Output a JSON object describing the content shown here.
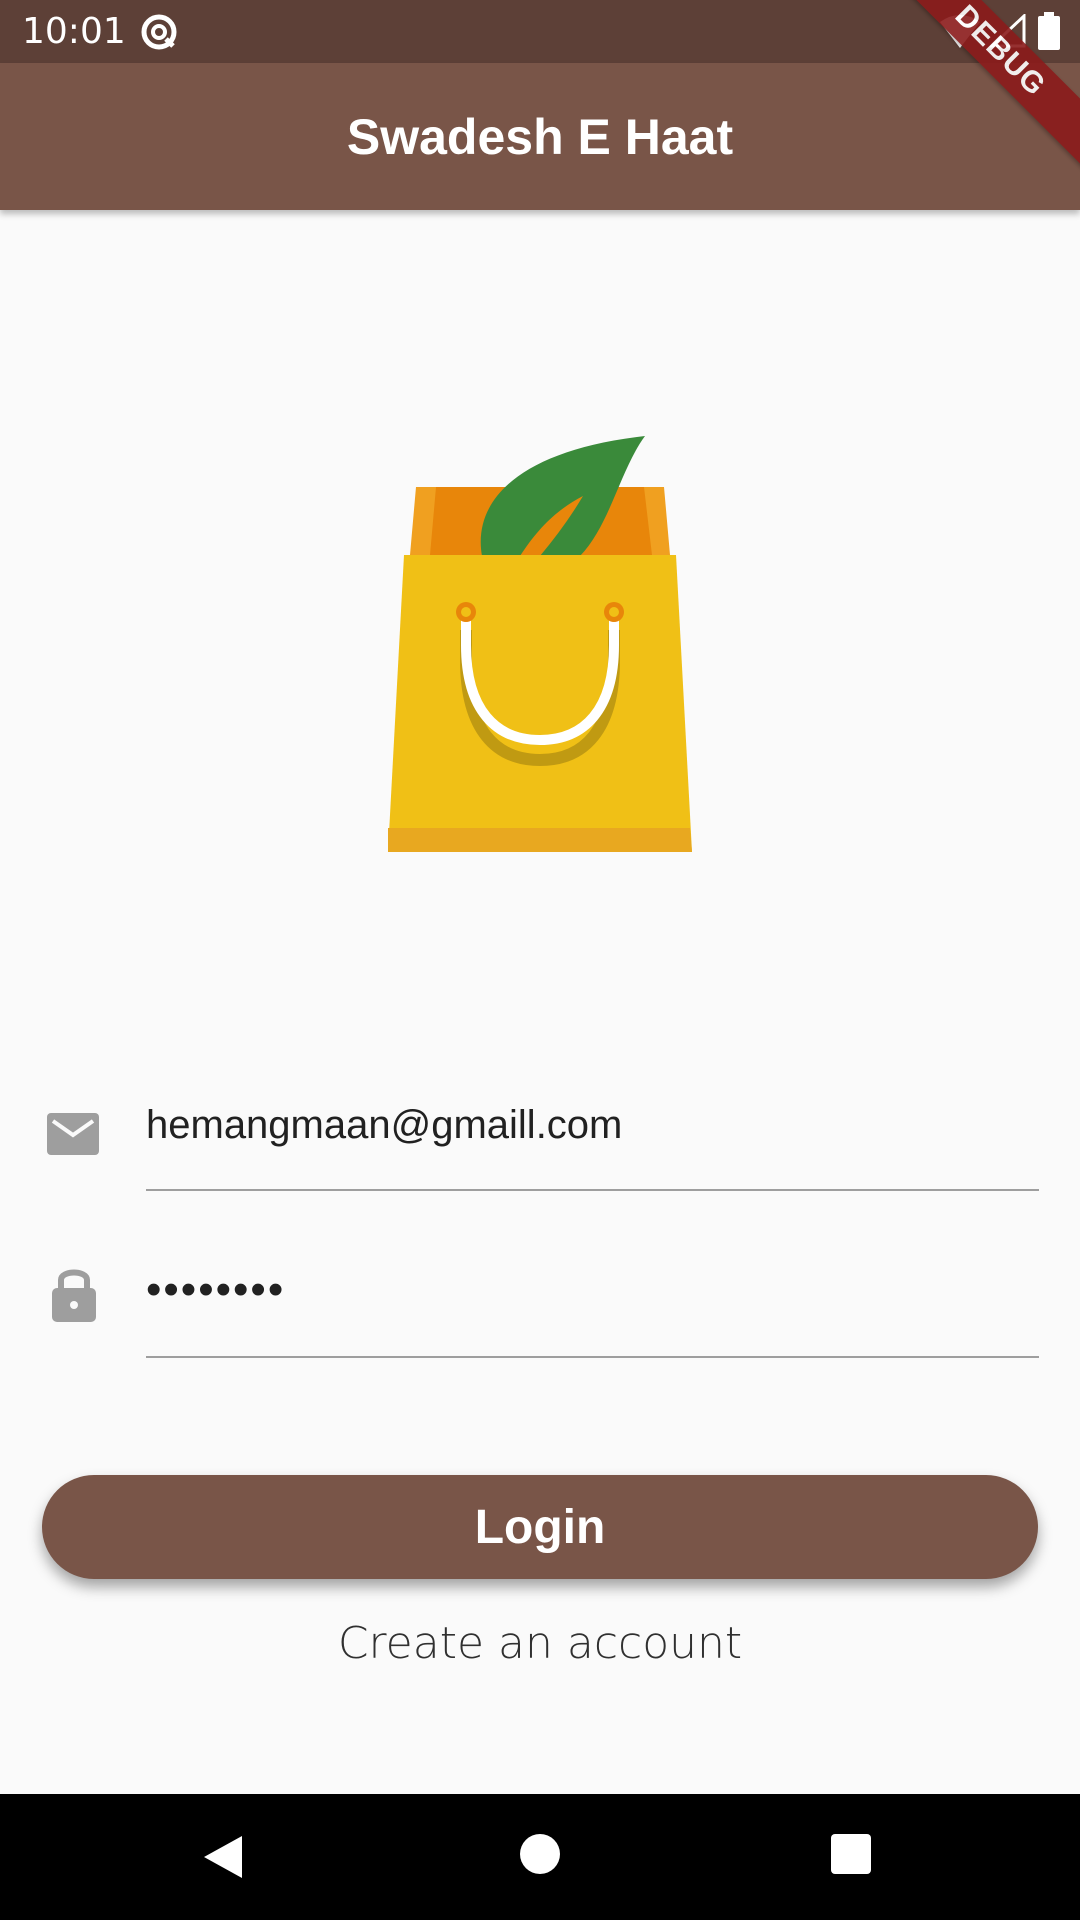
{
  "status_bar": {
    "time": "10:01",
    "app_icon": "at-sign-circle-icon",
    "icons": [
      "wifi-icon",
      "signal-icon",
      "battery-icon"
    ]
  },
  "app_bar": {
    "title": "Swadesh E Haat"
  },
  "debug_banner": "DEBUG",
  "logo": {
    "icon": "shopping-bag-leaf-icon"
  },
  "form": {
    "email": {
      "icon": "mail-icon",
      "value": "hemangmaan@gmaill.com"
    },
    "password": {
      "icon": "lock-icon",
      "value": "••••••••"
    },
    "login_label": "Login",
    "create_account_label": "Create an account"
  },
  "nav_bar": {
    "icons": [
      "back-icon",
      "home-icon",
      "recents-icon"
    ]
  },
  "colors": {
    "status_bar": "#5d4037",
    "app_bar": "#795548",
    "button": "#795548",
    "background": "#fafafa",
    "bag": "#f0c016",
    "leaf": "#3a8a3a"
  }
}
